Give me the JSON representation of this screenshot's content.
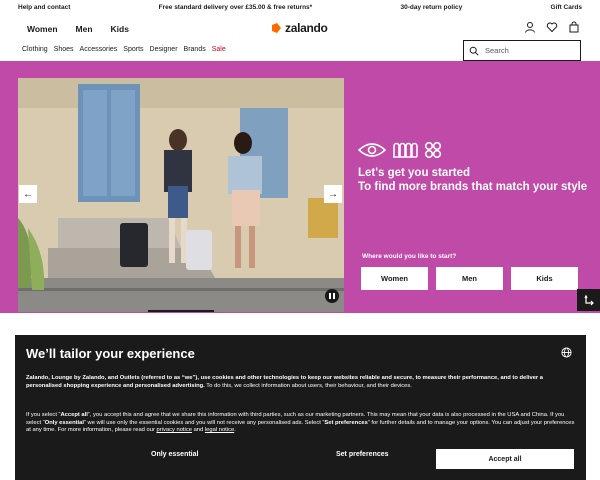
{
  "utility_bar": {
    "help": "Help and contact",
    "delivery": "Free standard delivery over £35.00 & free returns*",
    "returns": "30-day return policy",
    "gift_cards": "Gift Cards"
  },
  "header": {
    "gender_nav": [
      "Women",
      "Men",
      "Kids"
    ],
    "logo_text": "zalando",
    "icons": [
      "account-icon",
      "wishlist-icon",
      "bag-icon"
    ]
  },
  "category_nav": {
    "items": [
      "Clothing",
      "Shoes",
      "Accessories",
      "Sports",
      "Designer",
      "Brands"
    ],
    "sale": "Sale",
    "sale_color": "#d0021b"
  },
  "search": {
    "placeholder": "Search",
    "value": ""
  },
  "hero": {
    "background_color": "#c04aa7",
    "heading_line1": "Let's get you started",
    "heading_line2": "To find more brands that match your style",
    "start_label": "Where would you like to start?",
    "choices": [
      "Women",
      "Men",
      "Kids"
    ],
    "icons": [
      "eye-icon",
      "textile-icon",
      "grid-icon"
    ]
  },
  "cookie": {
    "title": "We’ll tailor your experience",
    "para1_bold": "Zalando, Lounge by Zalando, and Outlets (referred to as “we”), use cookies and other technologies to keep our websites reliable and secure, to measure their performance, and to deliver a personalised shopping experience and personalised advertising.",
    "para1_rest": " To do this, we collect information about users, their behaviour, and their devices.",
    "para2_a": "If you select “",
    "para2_accept": "Accept all",
    "para2_b": "”, you accept this and agree that we share this information with third parties, such as our marketing partners. This may mean that your data is also processed in the USA and China. If you select “",
    "para2_essential": "Only essential",
    "para2_c": "” we will use only the essential cookies and you will not receive any personalised ads. Select “",
    "para2_prefs": "Set preferences",
    "para2_d": "” for further details and to manage your options. You can adjust your preferences at any time. For more information, please read our ",
    "privacy_link": "privacy notice",
    "para2_and": " and ",
    "legal_link": "legal notice",
    "para2_end": ".",
    "btn_essential": "Only essential",
    "btn_preferences": "Set preferences",
    "btn_accept": "Accept all"
  }
}
